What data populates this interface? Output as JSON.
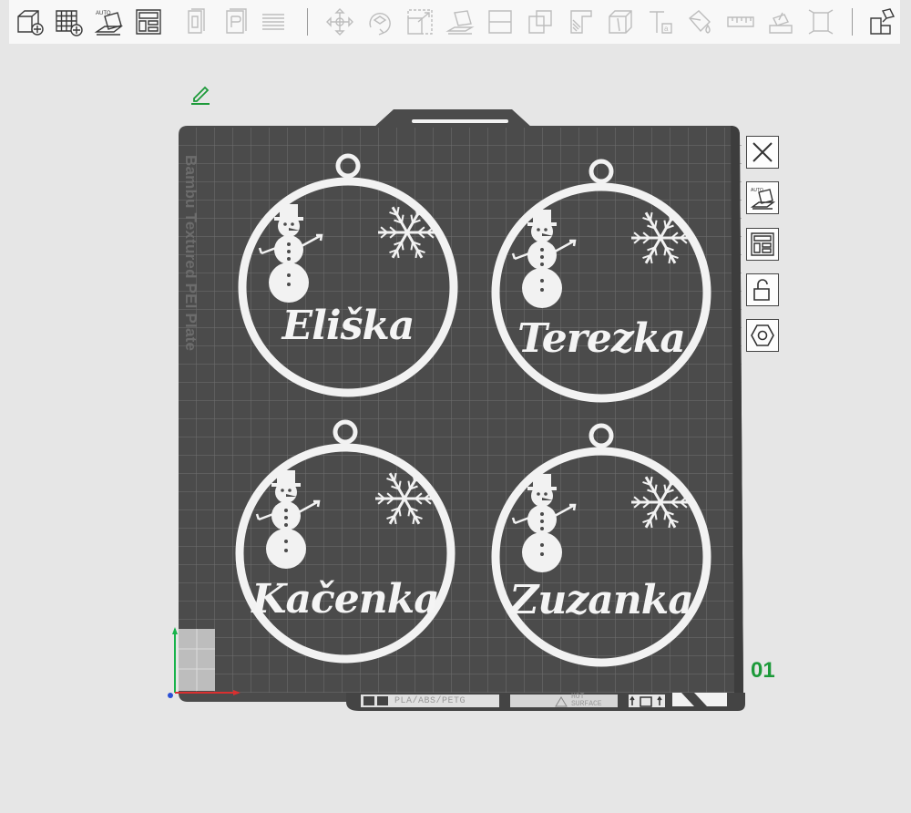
{
  "toolbar": {
    "auto_label": "AUTO",
    "buttons": [
      {
        "name": "add-object-button",
        "icon": "cube-plus-icon",
        "enabled": true
      },
      {
        "name": "add-plate-button",
        "icon": "grid-plus-icon",
        "enabled": true
      },
      {
        "name": "auto-orient-button",
        "icon": "auto-orient-icon",
        "enabled": true
      },
      {
        "name": "arrange-button",
        "icon": "arrange-layout-icon",
        "enabled": true
      },
      {
        "name": "copy-button",
        "icon": "copy-icon",
        "enabled": false
      },
      {
        "name": "paste-button",
        "icon": "paste-icon",
        "enabled": false
      },
      {
        "name": "layers-button",
        "icon": "layers-icon",
        "enabled": false
      },
      {
        "name": "move-button",
        "icon": "move-icon",
        "enabled": false
      },
      {
        "name": "rotate-button",
        "icon": "rotate-icon",
        "enabled": false
      },
      {
        "name": "scale-button",
        "icon": "scale-icon",
        "enabled": false
      },
      {
        "name": "lay-on-face-button",
        "icon": "lay-on-face-icon",
        "enabled": false
      },
      {
        "name": "cut-button",
        "icon": "cut-icon",
        "enabled": false
      },
      {
        "name": "boolean-button",
        "icon": "boolean-icon",
        "enabled": false
      },
      {
        "name": "support-paint-button",
        "icon": "support-paint-icon",
        "enabled": false
      },
      {
        "name": "seam-paint-button",
        "icon": "seam-paint-icon",
        "enabled": false
      },
      {
        "name": "text-button",
        "icon": "text-icon",
        "enabled": false
      },
      {
        "name": "color-paint-button",
        "icon": "paint-bucket-icon",
        "enabled": false
      },
      {
        "name": "measure-button",
        "icon": "ruler-icon",
        "enabled": false
      },
      {
        "name": "assembly-button",
        "icon": "assembly-icon",
        "enabled": false
      },
      {
        "name": "fit-view-button",
        "icon": "fit-view-icon",
        "enabled": false
      },
      {
        "name": "split-button",
        "icon": "split-objects-icon",
        "enabled": true
      }
    ]
  },
  "plate": {
    "label": "Bambu Textured PEI Plate",
    "number": "01",
    "filament_types": "PLA/ABS/PETG",
    "hot_surface": "HOT SURFACE",
    "side_buttons": [
      {
        "name": "remove-plate-button",
        "icon": "close-icon"
      },
      {
        "name": "auto-orient-plate-button",
        "icon": "auto-orient-icon"
      },
      {
        "name": "arrange-plate-button",
        "icon": "arrange-layout-icon"
      },
      {
        "name": "lock-plate-button",
        "icon": "lock-icon"
      },
      {
        "name": "plate-settings-button",
        "icon": "hexagon-settings-icon"
      }
    ]
  },
  "ornaments": [
    {
      "name": "Eliška"
    },
    {
      "name": "Terezka"
    },
    {
      "name": "Kačenka"
    },
    {
      "name": "Zuzanka"
    }
  ],
  "colors": {
    "plate": "#4b4b4b",
    "grid": "#6f6f6f",
    "ornament": "#f2f2f2",
    "accent": "#1d9a3a"
  }
}
